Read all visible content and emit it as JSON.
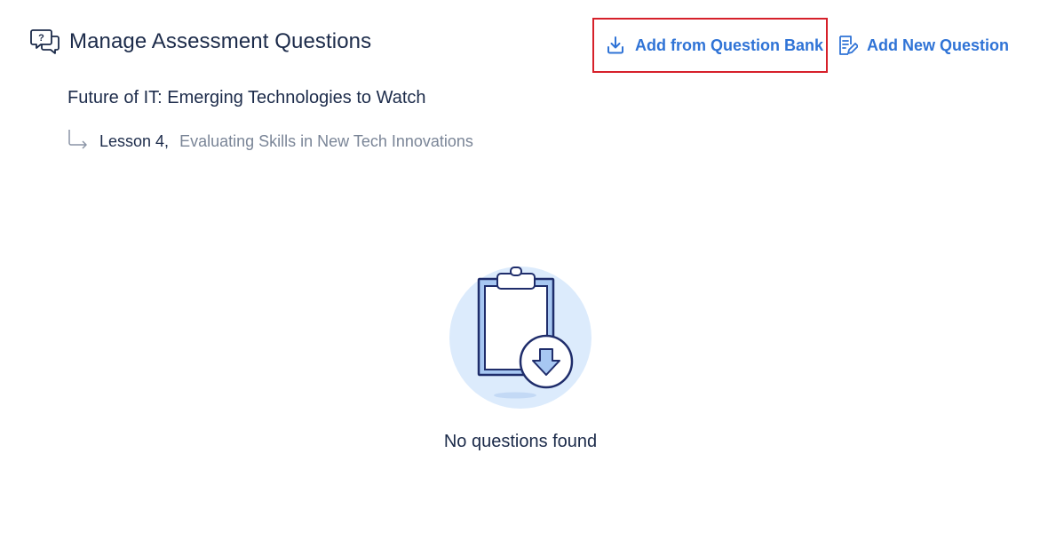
{
  "header": {
    "title": "Manage Assessment Questions",
    "icon": "chat-question-icon"
  },
  "actions": {
    "add_from_bank": {
      "label": "Add from Question Bank",
      "icon": "download-icon"
    },
    "add_new": {
      "label": "Add New Question",
      "icon": "edit-document-icon"
    }
  },
  "course": {
    "title": "Future of IT: Emerging Technologies to Watch"
  },
  "lesson": {
    "label": "Lesson 4,",
    "name": "Evaluating Skills in New Tech Innovations",
    "icon": "subdirectory-arrow-icon"
  },
  "empty_state": {
    "message": "No questions found",
    "icon": "clipboard-download-icon"
  },
  "colors": {
    "accent": "#2f73d6",
    "highlight_border": "#d6202a",
    "text_primary": "#1c2b4a",
    "text_secondary": "#7a8597",
    "illustration_bg": "#dcebfc"
  }
}
